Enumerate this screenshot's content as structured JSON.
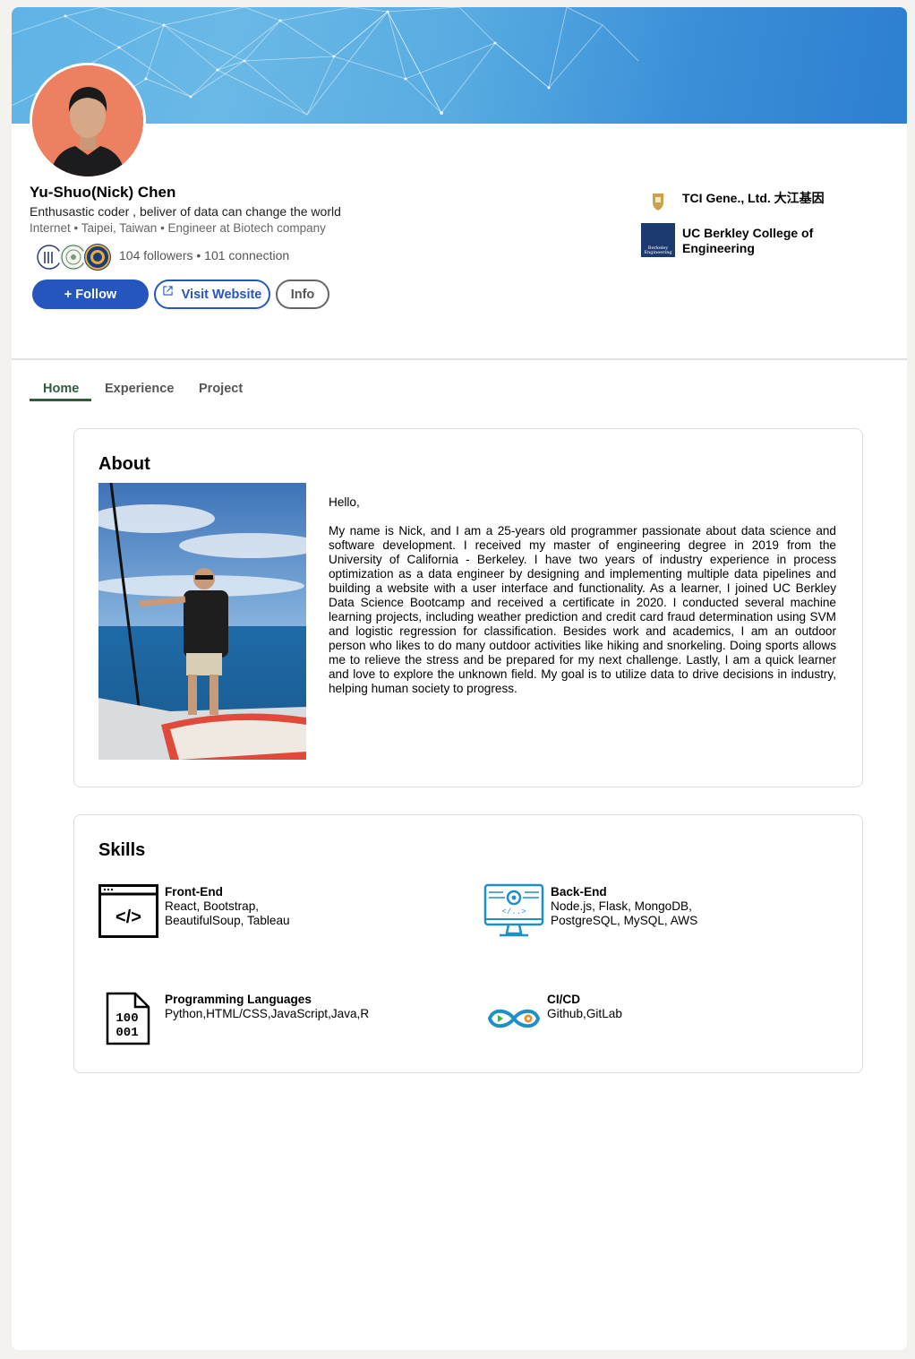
{
  "profile": {
    "name": "Yu-Shuo(Nick) Chen",
    "headline": "Enthusastic coder , beliver of data can change the world",
    "subline": "Internet • Taipei, Taiwan • Engineer at Biotech company",
    "stats": "104 followers • 101 connection"
  },
  "actions": {
    "follow": "+ Follow",
    "visit": "Visit Website",
    "info": "Info"
  },
  "companies": [
    {
      "name": "TCI Gene., Ltd. 大江基因",
      "icon": "tci-crest-icon"
    },
    {
      "name": "UC Berkley College of Engineering",
      "icon": "berkeley-logo-icon",
      "logo_text": "Berkeley Engineering"
    }
  ],
  "tabs": [
    {
      "label": "Home",
      "active": true
    },
    {
      "label": "Experience",
      "active": false
    },
    {
      "label": "Project",
      "active": false
    }
  ],
  "about": {
    "title": "About",
    "greeting": "Hello,",
    "body": "My name is Nick, and I am a 25-years old programmer passionate about data science and software development. I received my master of engineering degree in 2019 from the University of California - Berkeley. I have two years of industry experience in process optimization as a data engineer by designing and implementing multiple data pipelines and building a website with a user interface and functionality. As a learner, I joined UC Berkley Data Science Bootcamp and received a certificate in 2020. I conducted several machine learning projects, including weather prediction and credit card fraud determination using SVM and logistic regression for classification. Besides work and academics, I am an outdoor person who likes to do many outdoor activities like hiking and snorkeling. Doing sports allows me to relieve the stress and be prepared for my next challenge. Lastly, I am a quick learner and love to explore the unknown field. My goal is to utilize data to drive decisions in industry, helping human society to progress."
  },
  "skills": {
    "title": "Skills",
    "items": [
      {
        "title": "Front-End",
        "line1": "React, Bootstrap,",
        "line2": "BeautifulSoup, Tableau",
        "icon": "code-window-icon"
      },
      {
        "title": "Back-End",
        "line1": "Node.js, Flask, MongoDB,",
        "line2": "PostgreSQL, MySQL, AWS",
        "icon": "server-monitor-icon"
      },
      {
        "title": "Programming Languages",
        "line1": "Python,HTML/CSS,JavaScript,Java,R",
        "line2": "",
        "icon": "binary-file-icon"
      },
      {
        "title": "CI/CD",
        "line1": "Github,GitLab",
        "line2": "",
        "icon": "infinity-pipeline-icon"
      }
    ],
    "icon_text": {
      "code": "</>",
      "backend_code": "</..>",
      "binary1": "100",
      "binary2": "001"
    }
  },
  "colors": {
    "primary": "#2556bd",
    "tab_active": "#2c5d3f",
    "page_bg": "#f3f2ef",
    "skill_icon_blue": "#1f8fc9"
  }
}
